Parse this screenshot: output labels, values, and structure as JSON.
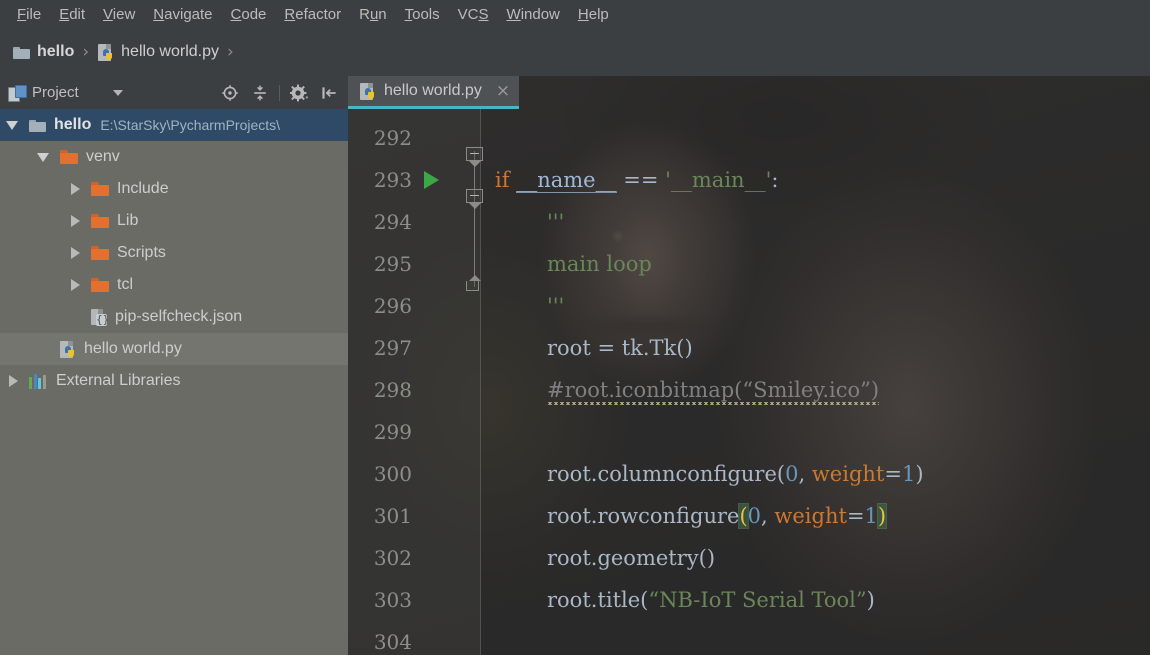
{
  "menubar": {
    "items": [
      {
        "label": "File",
        "mnemonic": "F"
      },
      {
        "label": "Edit",
        "mnemonic": "E"
      },
      {
        "label": "View",
        "mnemonic": "V"
      },
      {
        "label": "Navigate",
        "mnemonic": "N"
      },
      {
        "label": "Code",
        "mnemonic": "C"
      },
      {
        "label": "Refactor",
        "mnemonic": "R"
      },
      {
        "label": "Run",
        "mnemonic": "u"
      },
      {
        "label": "Tools",
        "mnemonic": "T"
      },
      {
        "label": "VCS",
        "mnemonic": "S"
      },
      {
        "label": "Window",
        "mnemonic": "W"
      },
      {
        "label": "Help",
        "mnemonic": "H"
      }
    ]
  },
  "breadcrumb": {
    "items": [
      {
        "label": "hello",
        "icon": "folder-icon"
      },
      {
        "label": "hello world.py",
        "icon": "python-file-icon"
      }
    ],
    "separator": "›"
  },
  "project_panel": {
    "title": "Project",
    "caret_icon": "chevron-down-icon",
    "toolbar_icons": [
      "locate-target-icon",
      "collapse-all-icon",
      "settings-gear-icon",
      "hide-panel-icon"
    ],
    "tree": [
      {
        "label": "hello",
        "sublabel": "E:\\StarSky\\PycharmProjects\\",
        "icon": "folder-icon",
        "arrow": "down",
        "depth": 0,
        "selected": true,
        "bold": true
      },
      {
        "label": "venv",
        "sublabel": "",
        "icon": "folder-orange-icon",
        "arrow": "down",
        "depth": 1,
        "selected": false,
        "bold": false
      },
      {
        "label": "Include",
        "sublabel": "",
        "icon": "folder-orange-icon",
        "arrow": "right",
        "depth": 2,
        "selected": false,
        "bold": false
      },
      {
        "label": "Lib",
        "sublabel": "",
        "icon": "folder-orange-icon",
        "arrow": "right",
        "depth": 2,
        "selected": false,
        "bold": false
      },
      {
        "label": "Scripts",
        "sublabel": "",
        "icon": "folder-orange-icon",
        "arrow": "right",
        "depth": 2,
        "selected": false,
        "bold": false
      },
      {
        "label": "tcl",
        "sublabel": "",
        "icon": "folder-orange-icon",
        "arrow": "right",
        "depth": 2,
        "selected": false,
        "bold": false
      },
      {
        "label": "pip-selfcheck.json",
        "sublabel": "",
        "icon": "json-file-icon",
        "arrow": "none",
        "depth": 2,
        "selected": false,
        "bold": false
      },
      {
        "label": "hello world.py",
        "sublabel": "",
        "icon": "python-file-icon",
        "arrow": "none",
        "depth": 1,
        "selected": false,
        "bold": false
      },
      {
        "label": "External Libraries",
        "sublabel": "",
        "icon": "libraries-icon",
        "arrow": "right",
        "depth": 0,
        "selected": false,
        "bold": false
      }
    ]
  },
  "editor": {
    "tabs": [
      {
        "label": "hello world.py",
        "icon": "python-file-icon",
        "active": true,
        "close_label": "×"
      }
    ],
    "first_line": 292,
    "lines": [
      {
        "num": 292,
        "indent": 0,
        "tokens": [],
        "run_marker": false
      },
      {
        "num": 293,
        "indent": 0,
        "run_marker": true,
        "tokens": [
          {
            "t": "if",
            "c": "s-kw"
          },
          {
            "t": " ",
            "c": "s-op"
          },
          {
            "t": "__name__",
            "c": "s-dun"
          },
          {
            "t": " == ",
            "c": "s-op"
          },
          {
            "t": "'__main__'",
            "c": "s-str"
          },
          {
            "t": ":",
            "c": "s-op"
          }
        ]
      },
      {
        "num": 294,
        "indent": 1,
        "run_marker": false,
        "tokens": [
          {
            "t": "'''",
            "c": "s-str"
          }
        ]
      },
      {
        "num": 295,
        "indent": 1,
        "run_marker": false,
        "tokens": [
          {
            "t": "main loop",
            "c": "s-str"
          }
        ]
      },
      {
        "num": 296,
        "indent": 1,
        "run_marker": false,
        "tokens": [
          {
            "t": "'''",
            "c": "s-str"
          }
        ]
      },
      {
        "num": 297,
        "indent": 1,
        "run_marker": false,
        "tokens": [
          {
            "t": "root",
            "c": "s-def"
          },
          {
            "t": " = ",
            "c": "s-op"
          },
          {
            "t": "tk.Tk()",
            "c": "s-def"
          }
        ]
      },
      {
        "num": 298,
        "indent": 1,
        "run_marker": false,
        "tokens": [
          {
            "t": "#root.iconbitmap(“Smiley.ico”)",
            "c": "s-comment"
          }
        ]
      },
      {
        "num": 299,
        "indent": 0,
        "run_marker": false,
        "tokens": []
      },
      {
        "num": 300,
        "indent": 1,
        "run_marker": false,
        "tokens": [
          {
            "t": "root.columnconfigure(",
            "c": "s-def"
          },
          {
            "t": "0",
            "c": "s-num"
          },
          {
            "t": ", ",
            "c": "s-op"
          },
          {
            "t": "weight",
            "c": "s-kwarg"
          },
          {
            "t": "=",
            "c": "s-op"
          },
          {
            "t": "1",
            "c": "s-num"
          },
          {
            "t": ")",
            "c": "s-def"
          }
        ]
      },
      {
        "num": 301,
        "indent": 1,
        "run_marker": false,
        "tokens": [
          {
            "t": "root.rowconfigure",
            "c": "s-def"
          },
          {
            "t": "(",
            "c": "brk-hl"
          },
          {
            "t": "0",
            "c": "s-num"
          },
          {
            "t": ", ",
            "c": "s-op"
          },
          {
            "t": "weight",
            "c": "s-kwarg"
          },
          {
            "t": "=",
            "c": "s-op"
          },
          {
            "t": "1",
            "c": "s-num"
          },
          {
            "t": ")",
            "c": "brk-hl"
          }
        ]
      },
      {
        "num": 302,
        "indent": 1,
        "run_marker": false,
        "tokens": [
          {
            "t": "root.geometry()",
            "c": "s-def"
          }
        ]
      },
      {
        "num": 303,
        "indent": 1,
        "run_marker": false,
        "tokens": [
          {
            "t": "root.title(",
            "c": "s-def"
          },
          {
            "t": "“NB-IoT Serial Tool”",
            "c": "s-str"
          },
          {
            "t": ")",
            "c": "s-def"
          }
        ]
      },
      {
        "num": 304,
        "indent": 0,
        "run_marker": false,
        "tokens": []
      }
    ]
  },
  "colors": {
    "chrome": "#3c3f41",
    "panel_bg": "#6b6b66",
    "selection_blue": "#2f4a66",
    "tab_underline": "#4eb3c9",
    "folder_orange": "#e2702e",
    "keyword_orange": "#cc7832",
    "string_green": "#6a8759",
    "number_blue": "#6897bb",
    "default_text": "#a9b7c6",
    "comment_grey": "#808080",
    "run_green": "#39a845"
  }
}
